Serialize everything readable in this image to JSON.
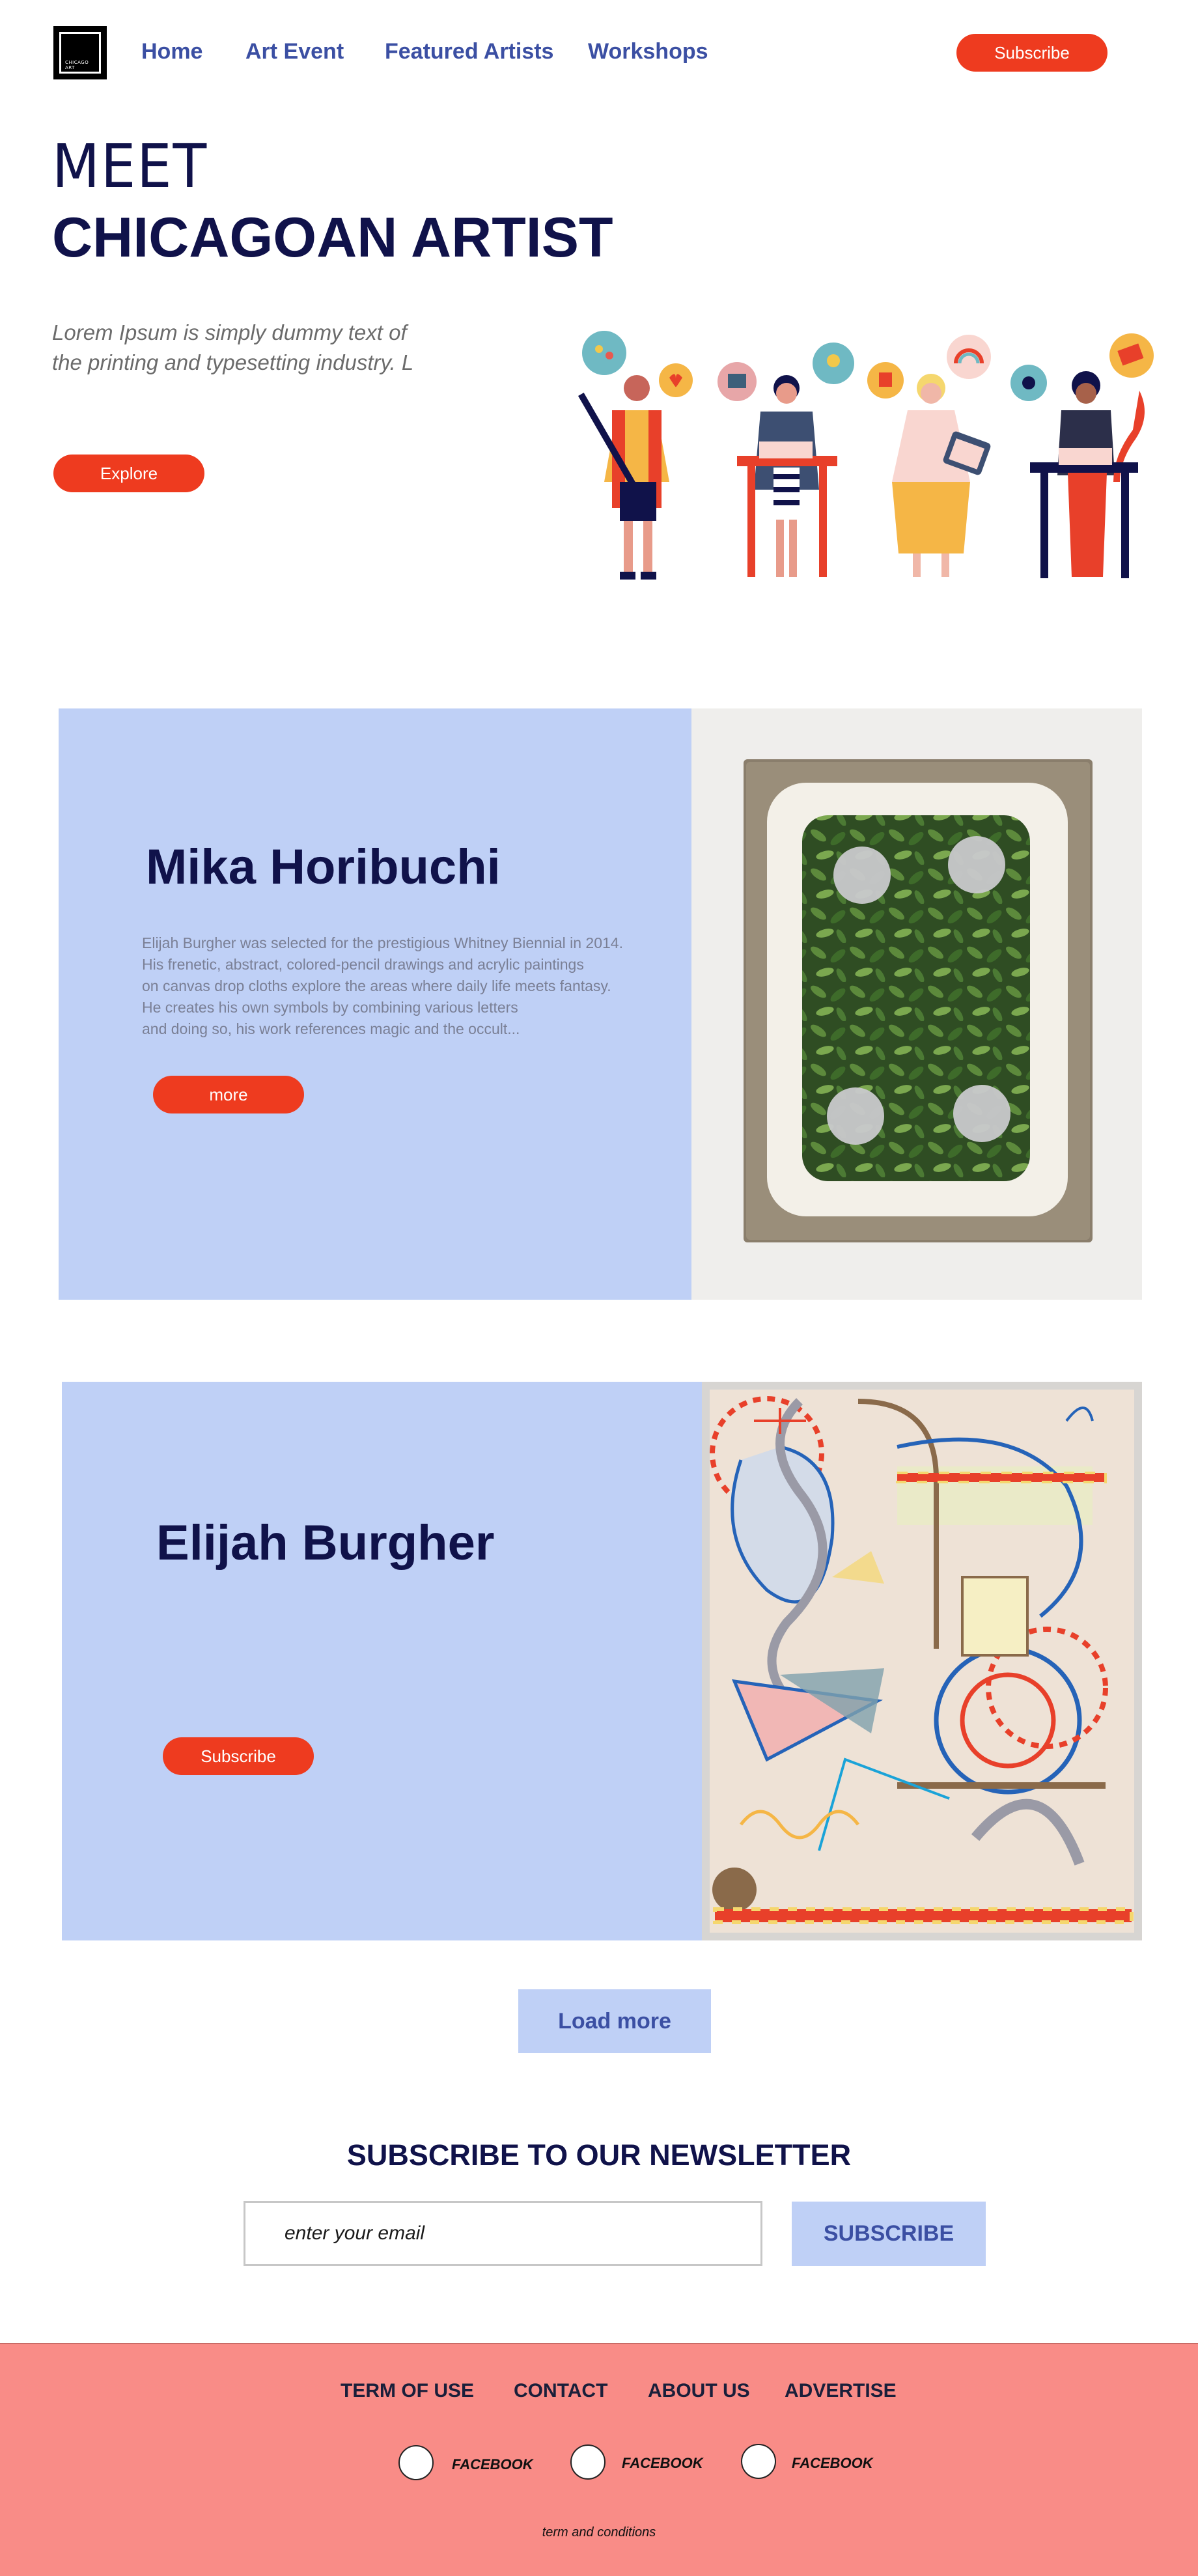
{
  "brand": {
    "logo_text": "CHICAGO ART"
  },
  "nav": {
    "links": [
      "Home",
      "Art Event",
      "Featured Artists",
      "Workshops"
    ],
    "subscribe_label": "Subscribe"
  },
  "hero": {
    "pre_title": "MEET",
    "title": "CHICAGOAN ARTIST",
    "subtitle": "Lorem Ipsum is simply dummy text of the printing and typesetting industry. L",
    "cta_label": "Explore"
  },
  "artists": [
    {
      "name": "Mika Horibuchi",
      "description": [
        "Elijah Burgher was selected for the prestigious Whitney Biennial in 2014.",
        "His frenetic, abstract, colored-pencil drawings and acrylic paintings",
        "on canvas drop cloths explore the areas where daily life meets fantasy.",
        "He creates his own symbols by combining various letters",
        "and doing so, his work references magic and the occult..."
      ],
      "button_label": "more",
      "artwork": "framed-leaf-painting"
    },
    {
      "name": "Elijah Burgher",
      "button_label": "Subscribe",
      "artwork": "abstract-symbol-painting"
    }
  ],
  "load_more_label": "Load more",
  "newsletter": {
    "title": "SUBSCRIBE TO OUR NEWSLETTER",
    "placeholder": "enter your email",
    "button_label": "SUBSCRIBE"
  },
  "footer": {
    "links": [
      "TERM OF USE",
      "CONTACT",
      "ABOUT US",
      "ADVERTISE"
    ],
    "socials": [
      "FACEBOOK",
      "FACEBOOK",
      "FACEBOOK"
    ],
    "terms": "term and conditions"
  },
  "colors": {
    "accent": "#ee3b1f",
    "panel": "#bfd0f6",
    "navy": "#10124a",
    "link": "#3b4fa3",
    "footer": "#f98c87"
  }
}
